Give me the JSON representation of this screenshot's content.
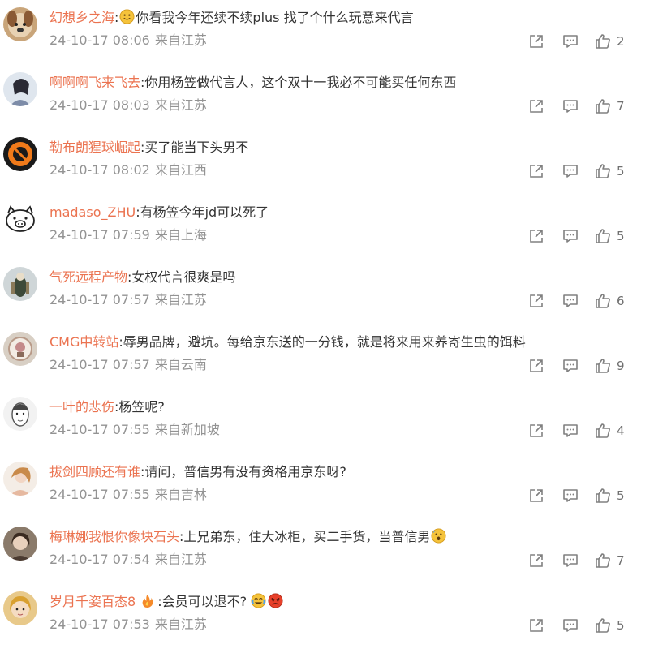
{
  "comments": [
    {
      "user": "幻想乡之海",
      "text_before": "你看我今年还续不续plus 找了个什么玩意来代言",
      "text_after": "",
      "lead_emoji": "smile-emoji",
      "date": "24-10-17 08:06",
      "location": "来自江苏",
      "likes": "2"
    },
    {
      "user": "啊啊啊飞来飞去",
      "text_before": "你用杨笠做代言人，这个双十一我必不可能买任何东西",
      "text_after": "",
      "date": "24-10-17 08:03",
      "location": "来自江苏",
      "likes": "7"
    },
    {
      "user": "勒布朗猩球崛起",
      "text_before": "买了能当下头男不",
      "text_after": "",
      "date": "24-10-17 08:02",
      "location": "来自江西",
      "likes": "5"
    },
    {
      "user": "madaso_ZHU",
      "text_before": "有杨笠今年jd可以死了",
      "text_after": "",
      "date": "24-10-17 07:59",
      "location": "来自上海",
      "likes": "5"
    },
    {
      "user": "气死远程产物",
      "text_before": "女权代言很爽是吗",
      "text_after": "",
      "date": "24-10-17 07:57",
      "location": "来自江苏",
      "likes": "6"
    },
    {
      "user": "CMG中转站",
      "text_before": "辱男品牌，避坑。每给京东送的一分钱，就是将来用来养寄生虫的饵料",
      "text_after": "",
      "date": "24-10-17 07:57",
      "location": "来自云南",
      "likes": "9"
    },
    {
      "user": "一叶的悲伤",
      "text_before": "杨笠呢?",
      "text_after": "",
      "date": "24-10-17 07:55",
      "location": "来自新加坡",
      "likes": "4"
    },
    {
      "user": "拔剑四顾还有谁",
      "text_before": "请问，普信男有没有资格用京东呀?",
      "text_after": "",
      "date": "24-10-17 07:55",
      "location": "来自吉林",
      "likes": "5"
    },
    {
      "user": "梅琳娜我恨你像块石头",
      "text_before": "上兄弟东，住大冰柜，买二手货，当普信男",
      "text_after": "",
      "tail_emoji": "scared-emoji",
      "date": "24-10-17 07:54",
      "location": "来自江苏",
      "likes": "7"
    },
    {
      "user": "岁月千姿百态8",
      "badge": "fire-badge-icon",
      "text_before": "会员可以退不?",
      "text_after": "",
      "tail_emoji": "crying-laugh-emoji",
      "tail_emoji2": "angry-emoji",
      "date": "24-10-17 07:53",
      "location": "来自江苏",
      "likes": "5"
    }
  ],
  "colors": {
    "username": "#eb7350",
    "text": "#333333",
    "meta": "#939393",
    "icon": "#808080"
  },
  "icons": {
    "share": "share-icon",
    "reply": "reply-icon",
    "like": "thumbs-up-icon"
  }
}
